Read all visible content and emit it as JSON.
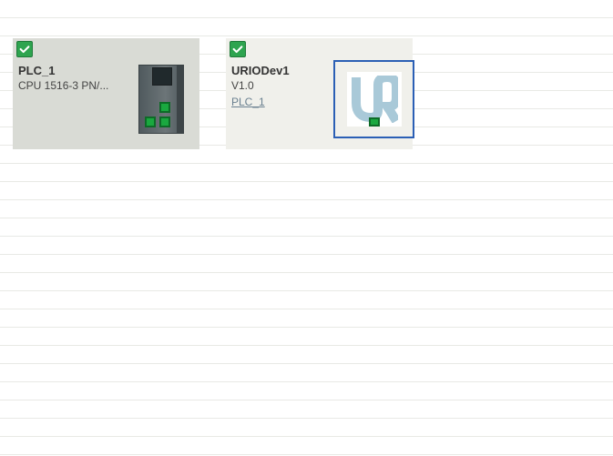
{
  "devices": [
    {
      "id": "plc",
      "name": "PLC_1",
      "subtitle": "CPU 1516-3 PN/...",
      "status": "ok",
      "selected": false
    },
    {
      "id": "urio",
      "name": "URIODev1",
      "subtitle": "V1.0",
      "link": "PLC_1",
      "status": "ok",
      "selected": true
    }
  ],
  "colors": {
    "selection": "#2b5fb5",
    "status_ok": "#2ea44f",
    "port": "#1aa83f"
  }
}
